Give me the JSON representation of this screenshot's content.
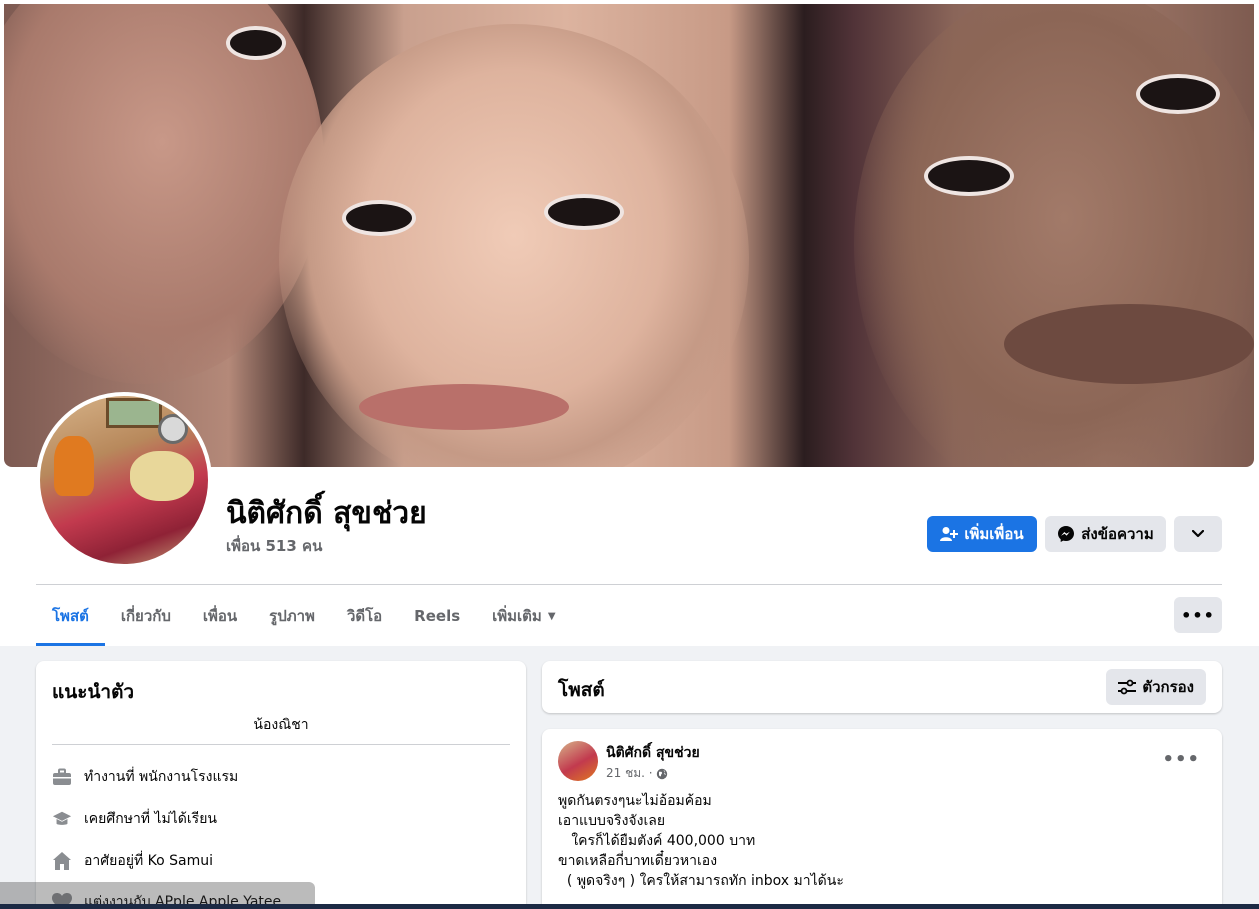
{
  "profile": {
    "name": "นิติศักดิ์ สุขช่วย",
    "friends": "เพื่อน 513 คน"
  },
  "actions": {
    "add_friend": "เพิ่มเพื่อน",
    "message": "ส่งข้อความ"
  },
  "tabs": [
    {
      "label": "โพสต์",
      "active": true
    },
    {
      "label": "เกี่ยวกับ"
    },
    {
      "label": "เพื่อน"
    },
    {
      "label": "รูปภาพ"
    },
    {
      "label": "วิดีโอ"
    },
    {
      "label": "Reels"
    },
    {
      "label": "เพิ่มเติม"
    }
  ],
  "intro": {
    "title": "แนะนำตัว",
    "bio": "น้องณิชา",
    "items": [
      {
        "icon": "briefcase-icon",
        "text": "ทำงานที่ พนักงานโรงแรม"
      },
      {
        "icon": "graduation-cap-icon",
        "text": "เคยศึกษาที่ ไม่ได้เรียน"
      },
      {
        "icon": "home-icon",
        "text": "อาศัยอยู่ที่ Ko Samui"
      },
      {
        "icon": "heart-icon",
        "text": "แต่งงานกับ APple Apple Yatee"
      }
    ]
  },
  "posts": {
    "title": "โพสต์",
    "filter_label": "ตัวกรอง"
  },
  "post": {
    "author": "นิติศักดิ์ สุขช่วย",
    "time": "21 ชม. ·",
    "lines": [
      "พูดกันตรงๆนะไม่อ้อมค้อม",
      "เอาแบบจริงจังเลย",
      "   ใครก็ได้ยืมตังค์ 400,000 บาท",
      "ขาดเหลือกี่บาทเดี๋ยวหาเอง",
      "  ( พูดจริงๆ ) ใครให้สามารถทัก inbox มาได้นะ"
    ]
  },
  "colors": {
    "accent": "#1b74e4",
    "background": "#f0f2f5",
    "secondary_button": "#e4e6eb"
  }
}
